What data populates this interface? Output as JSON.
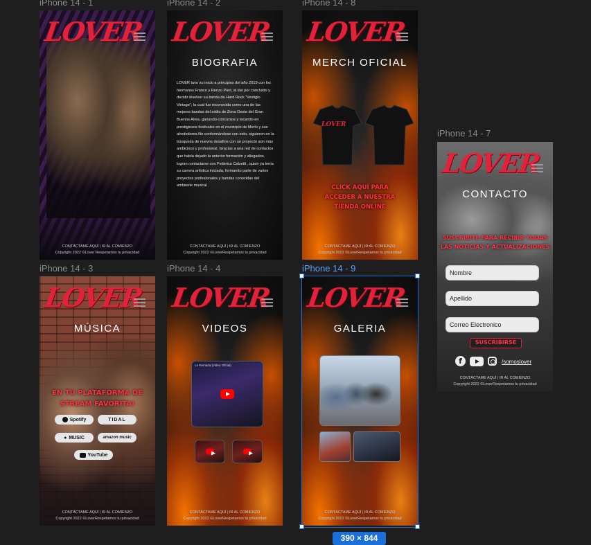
{
  "frames": {
    "f1": {
      "label": "iPhone 14 - 1"
    },
    "f2": {
      "label": "iPhone 14 - 2",
      "title": "BIOGRAFIA",
      "bio": "LOVER tuvo su inicio a principios del año 2019 con los hermanos Franco y Renzo Pieri, al dar por concluido y decidir disolver su banda de Hard Rock “Vestiglo Vintage”, la cual fue reconocida como una de las mejores bandas del estilo de Zona Oeste del Gran Buenos Aires, ganando concursos y tocando en prestigiosos festivales en el municipio de Merlo y sus alrededores.No conformándose con esto, siguieron en la búsqueda de nuevos desafíos con un proyecto aún más ambicioso y profesional. Gracias a una red de contactos que había dejado la anterior formación y allegados, logran contactarse con Federico Calzetti , quien ya tenía su carrera artística iniciada, formando parte de varios proyectos profesionales y bandas conocidas del ambiente musical"
    },
    "f8": {
      "label": "iPhone 14 - 8",
      "title": "MERCH OFICIAL",
      "cta": [
        "CLICK AQUÍ PARA",
        "ACCEDER A NUESTRA",
        "TIENDA ONLINE"
      ],
      "shirt_text": "LOVER"
    },
    "f7": {
      "label": "iPhone 14 - 7",
      "title": "CONTACTO",
      "cta": [
        "SUSCRIBITE PARA RECIBIR TODAS",
        "LAS NOTICIAS Y ACTUALIZACIONES"
      ],
      "fields": [
        "Nombre",
        "Apellido",
        "Correo Electronico"
      ],
      "button": "SUSCRIBIRSE",
      "handle": "/somoslover"
    },
    "f3": {
      "label": "iPhone 14 - 3",
      "title": "MÚSICA",
      "cta": [
        "EN TU PLATAFORMA  DE",
        "STREAM FAVORITA!"
      ],
      "platforms": [
        "Spotify",
        "TIDAL",
        "MUSIC",
        "amazon music",
        "YouTube"
      ]
    },
    "f4": {
      "label": "iPhone 14 - 4",
      "title": "VIDEOS",
      "video_caption": "La Remada (Video Oficial)"
    },
    "f9": {
      "label": "iPhone 14 - 9",
      "title": "GALERIA"
    }
  },
  "logo": "LOVER",
  "footer": {
    "line1": "CONTÁCTAME AQUÍ | IR AL COMIENZO",
    "line2_a": "Copyright 2022 ©Lover   Respetamos tu privacidad",
    "line2_b": "Copyright 2022 ©LoverRespetamos tu privacidad"
  },
  "selection_size": "390 × 844",
  "colors": {
    "accent": "#e0233a",
    "selection": "#1b6fd8"
  },
  "icons": [
    "hamburger-icon",
    "facebook-icon",
    "youtube-icon",
    "instagram-icon",
    "play-icon",
    "apple-icon"
  ]
}
